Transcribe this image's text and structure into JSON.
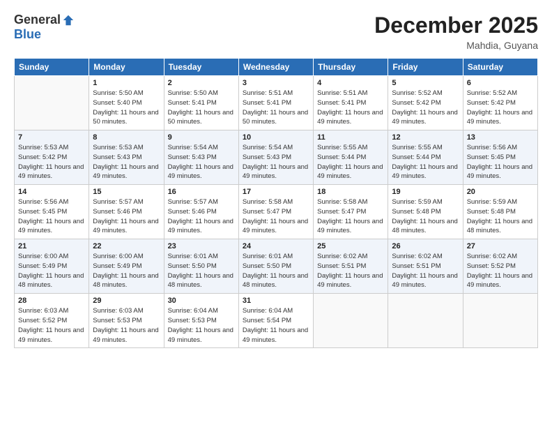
{
  "logo": {
    "general": "General",
    "blue": "Blue"
  },
  "title": "December 2025",
  "location": "Mahdia, Guyana",
  "days_of_week": [
    "Sunday",
    "Monday",
    "Tuesday",
    "Wednesday",
    "Thursday",
    "Friday",
    "Saturday"
  ],
  "weeks": [
    [
      {
        "day": "",
        "sunrise": "",
        "sunset": "",
        "daylight": ""
      },
      {
        "day": "1",
        "sunrise": "Sunrise: 5:50 AM",
        "sunset": "Sunset: 5:40 PM",
        "daylight": "Daylight: 11 hours and 50 minutes."
      },
      {
        "day": "2",
        "sunrise": "Sunrise: 5:50 AM",
        "sunset": "Sunset: 5:41 PM",
        "daylight": "Daylight: 11 hours and 50 minutes."
      },
      {
        "day": "3",
        "sunrise": "Sunrise: 5:51 AM",
        "sunset": "Sunset: 5:41 PM",
        "daylight": "Daylight: 11 hours and 50 minutes."
      },
      {
        "day": "4",
        "sunrise": "Sunrise: 5:51 AM",
        "sunset": "Sunset: 5:41 PM",
        "daylight": "Daylight: 11 hours and 49 minutes."
      },
      {
        "day": "5",
        "sunrise": "Sunrise: 5:52 AM",
        "sunset": "Sunset: 5:42 PM",
        "daylight": "Daylight: 11 hours and 49 minutes."
      },
      {
        "day": "6",
        "sunrise": "Sunrise: 5:52 AM",
        "sunset": "Sunset: 5:42 PM",
        "daylight": "Daylight: 11 hours and 49 minutes."
      }
    ],
    [
      {
        "day": "7",
        "sunrise": "Sunrise: 5:53 AM",
        "sunset": "Sunset: 5:42 PM",
        "daylight": "Daylight: 11 hours and 49 minutes."
      },
      {
        "day": "8",
        "sunrise": "Sunrise: 5:53 AM",
        "sunset": "Sunset: 5:43 PM",
        "daylight": "Daylight: 11 hours and 49 minutes."
      },
      {
        "day": "9",
        "sunrise": "Sunrise: 5:54 AM",
        "sunset": "Sunset: 5:43 PM",
        "daylight": "Daylight: 11 hours and 49 minutes."
      },
      {
        "day": "10",
        "sunrise": "Sunrise: 5:54 AM",
        "sunset": "Sunset: 5:43 PM",
        "daylight": "Daylight: 11 hours and 49 minutes."
      },
      {
        "day": "11",
        "sunrise": "Sunrise: 5:55 AM",
        "sunset": "Sunset: 5:44 PM",
        "daylight": "Daylight: 11 hours and 49 minutes."
      },
      {
        "day": "12",
        "sunrise": "Sunrise: 5:55 AM",
        "sunset": "Sunset: 5:44 PM",
        "daylight": "Daylight: 11 hours and 49 minutes."
      },
      {
        "day": "13",
        "sunrise": "Sunrise: 5:56 AM",
        "sunset": "Sunset: 5:45 PM",
        "daylight": "Daylight: 11 hours and 49 minutes."
      }
    ],
    [
      {
        "day": "14",
        "sunrise": "Sunrise: 5:56 AM",
        "sunset": "Sunset: 5:45 PM",
        "daylight": "Daylight: 11 hours and 49 minutes."
      },
      {
        "day": "15",
        "sunrise": "Sunrise: 5:57 AM",
        "sunset": "Sunset: 5:46 PM",
        "daylight": "Daylight: 11 hours and 49 minutes."
      },
      {
        "day": "16",
        "sunrise": "Sunrise: 5:57 AM",
        "sunset": "Sunset: 5:46 PM",
        "daylight": "Daylight: 11 hours and 49 minutes."
      },
      {
        "day": "17",
        "sunrise": "Sunrise: 5:58 AM",
        "sunset": "Sunset: 5:47 PM",
        "daylight": "Daylight: 11 hours and 49 minutes."
      },
      {
        "day": "18",
        "sunrise": "Sunrise: 5:58 AM",
        "sunset": "Sunset: 5:47 PM",
        "daylight": "Daylight: 11 hours and 49 minutes."
      },
      {
        "day": "19",
        "sunrise": "Sunrise: 5:59 AM",
        "sunset": "Sunset: 5:48 PM",
        "daylight": "Daylight: 11 hours and 48 minutes."
      },
      {
        "day": "20",
        "sunrise": "Sunrise: 5:59 AM",
        "sunset": "Sunset: 5:48 PM",
        "daylight": "Daylight: 11 hours and 48 minutes."
      }
    ],
    [
      {
        "day": "21",
        "sunrise": "Sunrise: 6:00 AM",
        "sunset": "Sunset: 5:49 PM",
        "daylight": "Daylight: 11 hours and 48 minutes."
      },
      {
        "day": "22",
        "sunrise": "Sunrise: 6:00 AM",
        "sunset": "Sunset: 5:49 PM",
        "daylight": "Daylight: 11 hours and 48 minutes."
      },
      {
        "day": "23",
        "sunrise": "Sunrise: 6:01 AM",
        "sunset": "Sunset: 5:50 PM",
        "daylight": "Daylight: 11 hours and 48 minutes."
      },
      {
        "day": "24",
        "sunrise": "Sunrise: 6:01 AM",
        "sunset": "Sunset: 5:50 PM",
        "daylight": "Daylight: 11 hours and 48 minutes."
      },
      {
        "day": "25",
        "sunrise": "Sunrise: 6:02 AM",
        "sunset": "Sunset: 5:51 PM",
        "daylight": "Daylight: 11 hours and 49 minutes."
      },
      {
        "day": "26",
        "sunrise": "Sunrise: 6:02 AM",
        "sunset": "Sunset: 5:51 PM",
        "daylight": "Daylight: 11 hours and 49 minutes."
      },
      {
        "day": "27",
        "sunrise": "Sunrise: 6:02 AM",
        "sunset": "Sunset: 5:52 PM",
        "daylight": "Daylight: 11 hours and 49 minutes."
      }
    ],
    [
      {
        "day": "28",
        "sunrise": "Sunrise: 6:03 AM",
        "sunset": "Sunset: 5:52 PM",
        "daylight": "Daylight: 11 hours and 49 minutes."
      },
      {
        "day": "29",
        "sunrise": "Sunrise: 6:03 AM",
        "sunset": "Sunset: 5:53 PM",
        "daylight": "Daylight: 11 hours and 49 minutes."
      },
      {
        "day": "30",
        "sunrise": "Sunrise: 6:04 AM",
        "sunset": "Sunset: 5:53 PM",
        "daylight": "Daylight: 11 hours and 49 minutes."
      },
      {
        "day": "31",
        "sunrise": "Sunrise: 6:04 AM",
        "sunset": "Sunset: 5:54 PM",
        "daylight": "Daylight: 11 hours and 49 minutes."
      },
      {
        "day": "",
        "sunrise": "",
        "sunset": "",
        "daylight": ""
      },
      {
        "day": "",
        "sunrise": "",
        "sunset": "",
        "daylight": ""
      },
      {
        "day": "",
        "sunrise": "",
        "sunset": "",
        "daylight": ""
      }
    ]
  ]
}
